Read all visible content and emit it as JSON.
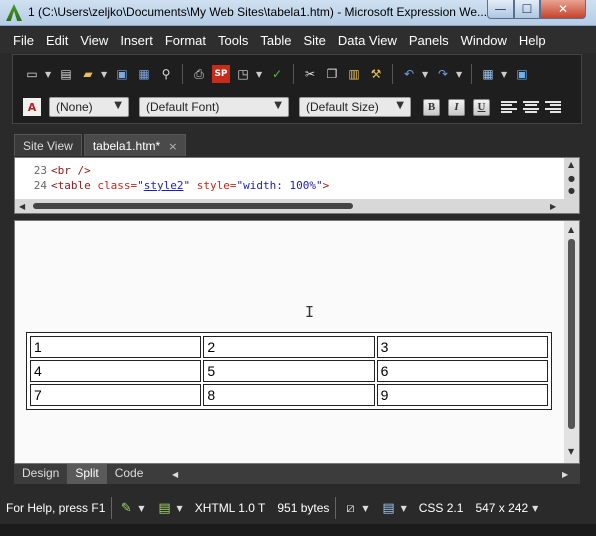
{
  "window": {
    "title": "1 (C:\\Users\\zeljko\\Documents\\My Web Sites\\tabela1.htm) - Microsoft Expression We...",
    "controls": {
      "minimize": "—",
      "maximize": "☐",
      "close": "✕"
    }
  },
  "menubar": [
    "File",
    "Edit",
    "View",
    "Insert",
    "Format",
    "Tools",
    "Table",
    "Site",
    "Data View",
    "Panels",
    "Window",
    "Help"
  ],
  "toolbar": {
    "icons": [
      "new-page-icon",
      "open-icon",
      "folder-icon",
      "save-icon",
      "save-all-icon",
      "find-icon",
      "print-icon",
      "sharepoint-icon",
      "preview-icon",
      "spelling-icon",
      "cut-icon",
      "copy-icon",
      "paste-icon",
      "format-painter-icon",
      "undo-icon",
      "redo-icon",
      "insert-table-icon",
      "insert-layer-icon"
    ],
    "style_select": "(None)",
    "font_select": "(Default Font)",
    "size_select": "(Default Size)",
    "bold": "B",
    "italic": "I",
    "underline": "U"
  },
  "tabs": {
    "site_view": "Site View",
    "file_tab": "tabela1.htm*",
    "close": "×"
  },
  "code": {
    "lines": [
      {
        "number": "23",
        "text": "<br />"
      },
      {
        "number": "24",
        "text": "<table class=\"style2\" style=\"width: 100%\">"
      }
    ],
    "line24": {
      "open": "<table ",
      "attr1": "class=",
      "val1_q1": "\"",
      "val1": "style2",
      "val1_q2": "\"",
      "attr2": " style=",
      "val2": "\"width: 100%\"",
      "close": ">"
    }
  },
  "design": {
    "table": [
      [
        "1",
        "2",
        "3"
      ],
      [
        "4",
        "5",
        "6"
      ],
      [
        "7",
        "8",
        "9"
      ]
    ]
  },
  "view_tabs": [
    "Design",
    "Split",
    "Code"
  ],
  "statusbar": {
    "help": "For Help, press F1",
    "doctype": "XHTML 1.0 T",
    "size": "951 bytes",
    "css": "CSS 2.1",
    "dimensions": "547 x 242"
  }
}
